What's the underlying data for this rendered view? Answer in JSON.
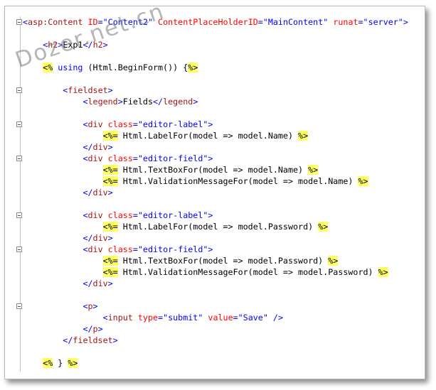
{
  "watermark": "Dozer.net.cn",
  "lines": [
    {
      "fold": true,
      "tokens": [
        {
          "t": "<",
          "c": "dl"
        },
        {
          "t": "asp:Content",
          "c": "tk"
        },
        {
          "t": " "
        },
        {
          "t": "ID",
          "c": "at"
        },
        {
          "t": "=\"Content2\"",
          "c": "av"
        },
        {
          "t": " "
        },
        {
          "t": "ContentPlaceHolderID",
          "c": "at"
        },
        {
          "t": "=\"MainContent\"",
          "c": "av"
        },
        {
          "t": " "
        },
        {
          "t": "runat",
          "c": "at"
        },
        {
          "t": "=\"server\"",
          "c": "av"
        },
        {
          "t": ">",
          "c": "dl"
        }
      ]
    },
    {
      "fold": false,
      "tokens": []
    },
    {
      "fold": false,
      "tokens": [
        {
          "t": "    "
        },
        {
          "t": "<",
          "c": "dl"
        },
        {
          "t": "h2",
          "c": "tk"
        },
        {
          "t": ">",
          "c": "dl"
        },
        {
          "t": "Exp1"
        },
        {
          "t": "</",
          "c": "dl"
        },
        {
          "t": "h2",
          "c": "tk"
        },
        {
          "t": ">",
          "c": "dl"
        }
      ]
    },
    {
      "fold": false,
      "tokens": []
    },
    {
      "fold": false,
      "tokens": [
        {
          "t": "    "
        },
        {
          "t": "<%",
          "c": "hl"
        },
        {
          "t": " "
        },
        {
          "t": "using",
          "c": "kw"
        },
        {
          "t": " (Html.BeginForm()) {"
        },
        {
          "t": "%>",
          "c": "hl"
        }
      ]
    },
    {
      "fold": false,
      "tokens": []
    },
    {
      "fold": true,
      "tokens": [
        {
          "t": "        "
        },
        {
          "t": "<",
          "c": "dl"
        },
        {
          "t": "fieldset",
          "c": "tk"
        },
        {
          "t": ">",
          "c": "dl"
        }
      ]
    },
    {
      "fold": false,
      "tokens": [
        {
          "t": "            "
        },
        {
          "t": "<",
          "c": "dl"
        },
        {
          "t": "legend",
          "c": "tk"
        },
        {
          "t": ">",
          "c": "dl"
        },
        {
          "t": "Fields"
        },
        {
          "t": "</",
          "c": "dl"
        },
        {
          "t": "legend",
          "c": "tk"
        },
        {
          "t": ">",
          "c": "dl"
        }
      ]
    },
    {
      "fold": false,
      "tokens": []
    },
    {
      "fold": true,
      "tokens": [
        {
          "t": "            "
        },
        {
          "t": "<",
          "c": "dl"
        },
        {
          "t": "div",
          "c": "tk"
        },
        {
          "t": " "
        },
        {
          "t": "class",
          "c": "at"
        },
        {
          "t": "=\"editor-label\"",
          "c": "av"
        },
        {
          "t": ">",
          "c": "dl"
        }
      ]
    },
    {
      "fold": false,
      "tokens": [
        {
          "t": "                "
        },
        {
          "t": "<%=",
          "c": "hl"
        },
        {
          "t": " Html.LabelFor(model => model.Name) "
        },
        {
          "t": "%>",
          "c": "hl"
        }
      ]
    },
    {
      "fold": false,
      "tokens": [
        {
          "t": "            "
        },
        {
          "t": "</",
          "c": "dl"
        },
        {
          "t": "div",
          "c": "tk"
        },
        {
          "t": ">",
          "c": "dl"
        }
      ]
    },
    {
      "fold": true,
      "tokens": [
        {
          "t": "            "
        },
        {
          "t": "<",
          "c": "dl"
        },
        {
          "t": "div",
          "c": "tk"
        },
        {
          "t": " "
        },
        {
          "t": "class",
          "c": "at"
        },
        {
          "t": "=\"editor-field\"",
          "c": "av"
        },
        {
          "t": ">",
          "c": "dl"
        }
      ]
    },
    {
      "fold": false,
      "tokens": [
        {
          "t": "                "
        },
        {
          "t": "<%=",
          "c": "hl"
        },
        {
          "t": " Html.TextBoxFor(model => model.Name) "
        },
        {
          "t": "%>",
          "c": "hl"
        }
      ]
    },
    {
      "fold": false,
      "tokens": [
        {
          "t": "                "
        },
        {
          "t": "<%=",
          "c": "hl"
        },
        {
          "t": " Html.ValidationMessageFor(model => model.Name) "
        },
        {
          "t": "%>",
          "c": "hl"
        }
      ]
    },
    {
      "fold": false,
      "tokens": [
        {
          "t": "            "
        },
        {
          "t": "</",
          "c": "dl"
        },
        {
          "t": "div",
          "c": "tk"
        },
        {
          "t": ">",
          "c": "dl"
        }
      ]
    },
    {
      "fold": false,
      "tokens": []
    },
    {
      "fold": true,
      "tokens": [
        {
          "t": "            "
        },
        {
          "t": "<",
          "c": "dl"
        },
        {
          "t": "div",
          "c": "tk"
        },
        {
          "t": " "
        },
        {
          "t": "class",
          "c": "at"
        },
        {
          "t": "=\"editor-label\"",
          "c": "av"
        },
        {
          "t": ">",
          "c": "dl"
        }
      ]
    },
    {
      "fold": false,
      "tokens": [
        {
          "t": "                "
        },
        {
          "t": "<%=",
          "c": "hl"
        },
        {
          "t": " Html.LabelFor(model => model.Password) "
        },
        {
          "t": "%>",
          "c": "hl"
        }
      ]
    },
    {
      "fold": false,
      "tokens": [
        {
          "t": "            "
        },
        {
          "t": "</",
          "c": "dl"
        },
        {
          "t": "div",
          "c": "tk"
        },
        {
          "t": ">",
          "c": "dl"
        }
      ]
    },
    {
      "fold": true,
      "tokens": [
        {
          "t": "            "
        },
        {
          "t": "<",
          "c": "dl"
        },
        {
          "t": "div",
          "c": "tk"
        },
        {
          "t": " "
        },
        {
          "t": "class",
          "c": "at"
        },
        {
          "t": "=\"editor-field\"",
          "c": "av"
        },
        {
          "t": ">",
          "c": "dl"
        }
      ]
    },
    {
      "fold": false,
      "tokens": [
        {
          "t": "                "
        },
        {
          "t": "<%=",
          "c": "hl"
        },
        {
          "t": " Html.TextBoxFor(model => model.Password) "
        },
        {
          "t": "%>",
          "c": "hl"
        }
      ]
    },
    {
      "fold": false,
      "tokens": [
        {
          "t": "                "
        },
        {
          "t": "<%=",
          "c": "hl"
        },
        {
          "t": " Html.ValidationMessageFor(model => model.Password) "
        },
        {
          "t": "%>",
          "c": "hl"
        }
      ]
    },
    {
      "fold": false,
      "tokens": [
        {
          "t": "            "
        },
        {
          "t": "</",
          "c": "dl"
        },
        {
          "t": "div",
          "c": "tk"
        },
        {
          "t": ">",
          "c": "dl"
        }
      ]
    },
    {
      "fold": false,
      "tokens": []
    },
    {
      "fold": true,
      "tokens": [
        {
          "t": "            "
        },
        {
          "t": "<",
          "c": "dl"
        },
        {
          "t": "p",
          "c": "tk"
        },
        {
          "t": ">",
          "c": "dl"
        }
      ]
    },
    {
      "fold": false,
      "tokens": [
        {
          "t": "                "
        },
        {
          "t": "<",
          "c": "dl"
        },
        {
          "t": "input",
          "c": "tk"
        },
        {
          "t": " "
        },
        {
          "t": "type",
          "c": "at"
        },
        {
          "t": "=\"submit\"",
          "c": "av"
        },
        {
          "t": " "
        },
        {
          "t": "value",
          "c": "at"
        },
        {
          "t": "=\"Save\"",
          "c": "av"
        },
        {
          "t": " "
        },
        {
          "t": "/>",
          "c": "dl"
        }
      ]
    },
    {
      "fold": false,
      "tokens": [
        {
          "t": "            "
        },
        {
          "t": "</",
          "c": "dl"
        },
        {
          "t": "p",
          "c": "tk"
        },
        {
          "t": ">",
          "c": "dl"
        }
      ]
    },
    {
      "fold": false,
      "tokens": [
        {
          "t": "        "
        },
        {
          "t": "</",
          "c": "dl"
        },
        {
          "t": "fieldset",
          "c": "tk"
        },
        {
          "t": ">",
          "c": "dl"
        }
      ]
    },
    {
      "fold": false,
      "tokens": []
    },
    {
      "fold": false,
      "tokens": [
        {
          "t": "    "
        },
        {
          "t": "<%",
          "c": "hl"
        },
        {
          "t": " } "
        },
        {
          "t": "%>",
          "c": "hl"
        }
      ]
    }
  ]
}
